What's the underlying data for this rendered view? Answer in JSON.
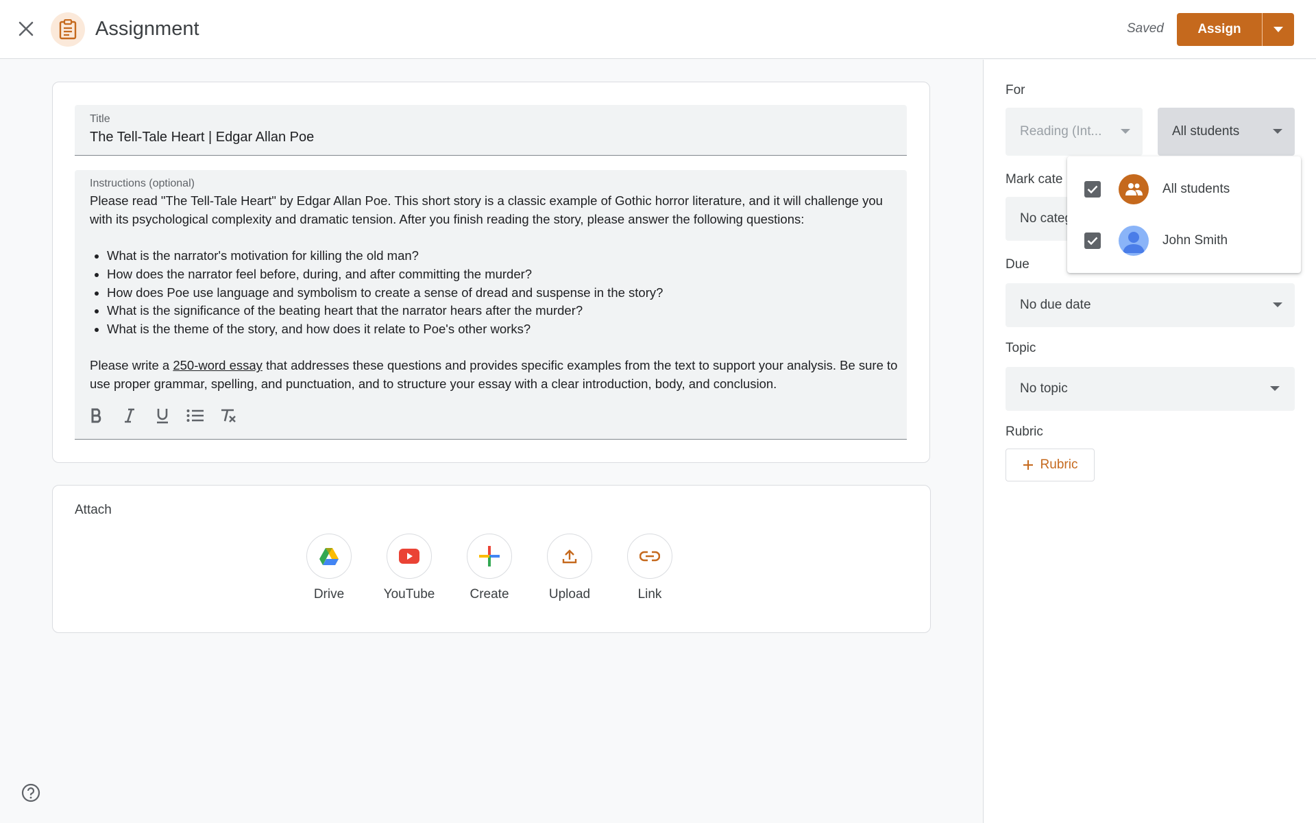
{
  "header": {
    "title": "Assignment",
    "status": "Saved",
    "assign_label": "Assign"
  },
  "details": {
    "title_label": "Title",
    "title_value": "The Tell-Tale Heart | Edgar Allan Poe",
    "instructions_label": "Instructions (optional)",
    "instructions_intro": "Please read \"The Tell-Tale Heart\" by Edgar Allan Poe. This short story is a classic example of Gothic horror literature, and it will challenge you with its psychological complexity and dramatic tension. After you finish reading the story, please answer the following questions:",
    "questions": [
      "What is the narrator's motivation for killing the old man?",
      "How does the narrator feel before, during, and after committing the murder?",
      "How does Poe use language and symbolism to create a sense of dread and suspense in the story?",
      "What is the significance of the beating heart that the narrator hears after the murder?",
      "What is the theme of the story, and how does it relate to Poe's other works?"
    ],
    "outro_before": "Please write a ",
    "outro_link": "250-word essay",
    "outro_after": " that addresses these questions and provides specific examples from the text to support your analysis. Be sure to use proper grammar, spelling, and punctuation, and to structure your essay with a clear introduction, body, and conclusion."
  },
  "format_toolbar": [
    "bold-icon",
    "italic-icon",
    "underline-icon",
    "bulleted-list-icon",
    "clear-formatting-icon"
  ],
  "attach": {
    "title": "Attach",
    "items": [
      {
        "label": "Drive",
        "icon": "drive-icon"
      },
      {
        "label": "YouTube",
        "icon": "youtube-icon"
      },
      {
        "label": "Create",
        "icon": "plus-icon"
      },
      {
        "label": "Upload",
        "icon": "upload-icon"
      },
      {
        "label": "Link",
        "icon": "link-icon"
      }
    ]
  },
  "sidebar": {
    "for_label": "For",
    "class_value": "Reading (Int...",
    "students_value": "All students",
    "mark_category_label": "Mark cate",
    "category_value": "No categ",
    "due_label": "Due",
    "due_value": "No due date",
    "topic_label": "Topic",
    "topic_value": "No topic",
    "rubric_label": "Rubric",
    "rubric_button": "Rubric"
  },
  "students_dropdown": {
    "items": [
      {
        "name": "All students",
        "checked": true,
        "avatar": "group-icon"
      },
      {
        "name": "John Smith",
        "checked": true,
        "avatar": "person-icon"
      }
    ]
  },
  "colors": {
    "accent": "#c5691d",
    "accent_light": "#fbe9da",
    "field_bg": "#f1f3f4"
  }
}
